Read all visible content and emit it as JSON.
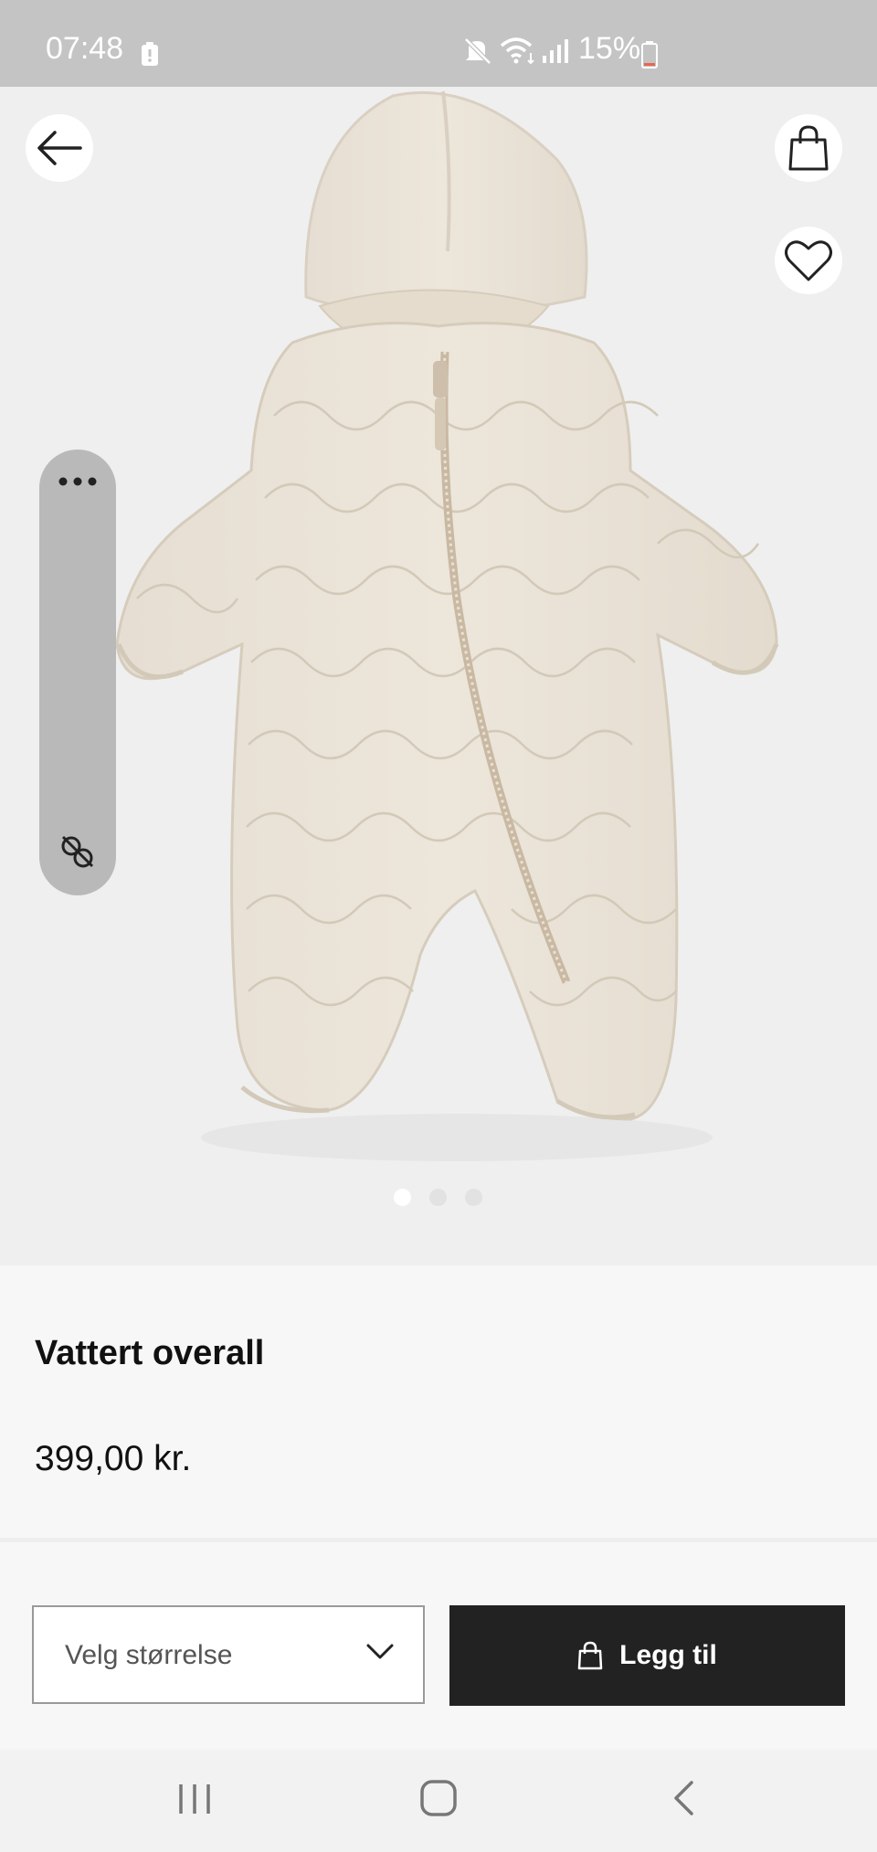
{
  "status_bar": {
    "time": "07:48",
    "battery_percent": "15%",
    "icons": [
      "battery-saver-icon",
      "mute-icon",
      "wifi-icon",
      "signal-icon",
      "battery-icon"
    ]
  },
  "hero": {
    "image_icon": "snowsuit-product-image",
    "buttons": [
      "back-arrow-icon",
      "shopping-bag-icon",
      "heart-icon"
    ],
    "side_panel_icons": [
      "more-dots-icon",
      "close-panel-icon"
    ],
    "pager": {
      "count": 3,
      "active_index": 0
    }
  },
  "product": {
    "title": "Vattert overall",
    "price": "399,00 kr."
  },
  "actions": {
    "size_placeholder": "Velg størrelse",
    "add_label": "Legg til"
  },
  "nav": {
    "icons": [
      "recent-apps-icon",
      "home-icon",
      "back-icon"
    ]
  },
  "colors": {
    "status_bar": "#c4c4c4",
    "button_dark": "#222222",
    "background": "#f7f7f7",
    "hero_background": "#eeeeee",
    "battery_low": "#e8674f"
  }
}
